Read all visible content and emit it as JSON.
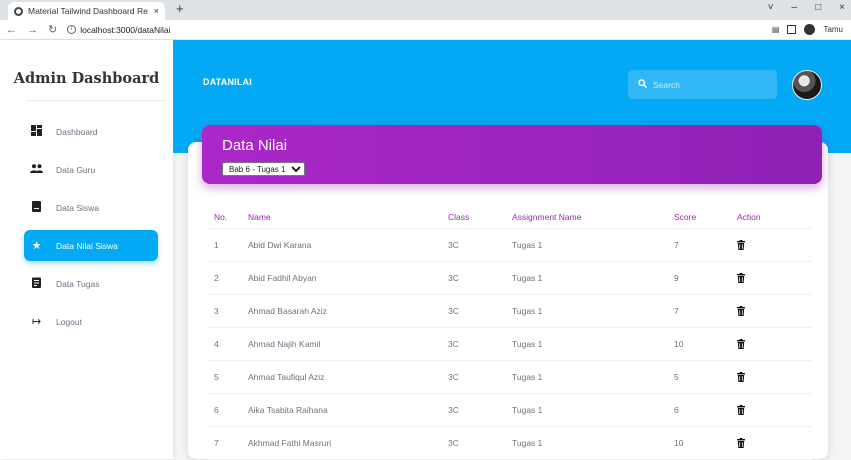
{
  "browser": {
    "tab_title": "Material Tailwind Dashboard Re…",
    "tab_close": "×",
    "new_tab": "+",
    "url": "localhost:3000/dataNilai",
    "profile_label": "Tamu",
    "window_controls": [
      "˅",
      "–",
      "□",
      "×"
    ]
  },
  "sidebar": {
    "brand": "Admin Dashboard",
    "items": [
      {
        "label": "Dashboard",
        "icon": "dashboard-icon",
        "active": false
      },
      {
        "label": "Data Guru",
        "icon": "people-icon",
        "active": false
      },
      {
        "label": "Data Siswa",
        "icon": "student-icon",
        "active": false
      },
      {
        "label": "Data Nilai Siswa",
        "icon": "star-icon",
        "active": true
      },
      {
        "label": "Data Tugas",
        "icon": "assignment-icon",
        "active": false
      },
      {
        "label": "Logout",
        "icon": "logout-icon",
        "active": false
      }
    ]
  },
  "header": {
    "breadcrumb": "DATANILAI",
    "search_placeholder": "Search"
  },
  "card": {
    "title": "Data Nilai",
    "selected_option": "Bab 6 - Tugas 1",
    "columns": [
      "No.",
      "Name",
      "Class",
      "Assignment Name",
      "Score",
      "Action"
    ],
    "rows": [
      [
        "1",
        "Abid Dwi Karana",
        "3C",
        "Tugas 1",
        "7"
      ],
      [
        "2",
        "Abid Fadhil Abyan",
        "3C",
        "Tugas 1",
        "9"
      ],
      [
        "3",
        "Ahmad Basarah Aziz",
        "3C",
        "Tugas 1",
        "7"
      ],
      [
        "4",
        "Ahmad Najih Kamil",
        "3C",
        "Tugas 1",
        "10"
      ],
      [
        "5",
        "Ahmad Taufiqul Aziz",
        "3C",
        "Tugas 1",
        "5"
      ],
      [
        "6",
        "Aika Tsabita Raihana",
        "3C",
        "Tugas 1",
        "6"
      ],
      [
        "7",
        "Akhmad Fathi Masruri",
        "3C",
        "Tugas 1",
        "10"
      ]
    ]
  },
  "colors": {
    "accent_blue": "#03a9f4",
    "card_purple": "#9c27b0"
  }
}
